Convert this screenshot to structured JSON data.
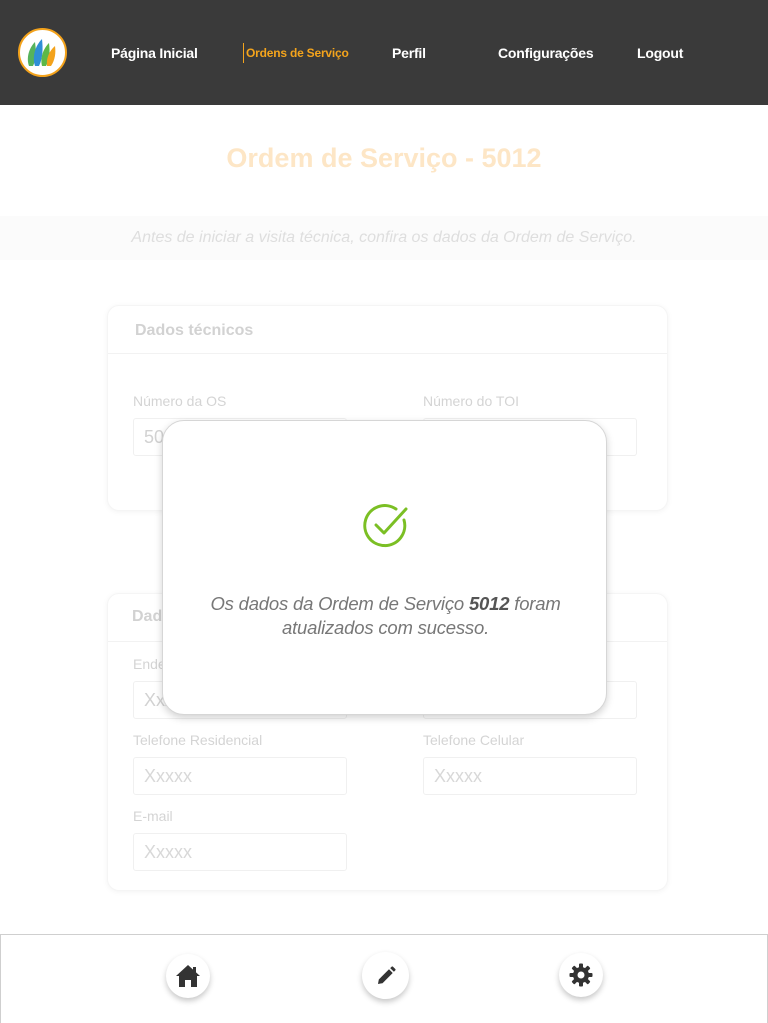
{
  "nav": {
    "items": [
      {
        "label": "Página Inicial",
        "active": false
      },
      {
        "label": "Ordens de Serviço",
        "active": true
      },
      {
        "label": "Perfil",
        "active": false
      },
      {
        "label": "Configurações",
        "active": false
      },
      {
        "label": "Logout",
        "active": false
      }
    ],
    "logo_icon": "company-logo"
  },
  "page": {
    "title": "Ordem de Serviço - 5012",
    "subtitle": "Antes de iniciar a visita técnica, confira os dados da Ordem de Serviço."
  },
  "technical": {
    "title": "Dados técnicos",
    "os_number_label": "Número da OS",
    "os_number_value": "5012",
    "toi_number_label": "Número do TOI",
    "toi_number_value": ""
  },
  "client": {
    "title": "Dados do cliente",
    "address_label": "Endereço",
    "address_value": "Xxxxx",
    "address2_value": "",
    "phone_res_label": "Telefone Residencial",
    "phone_res_placeholder": "Xxxxx",
    "phone_cel_label": "Telefone Celular",
    "phone_cel_placeholder": "Xxxxx",
    "email_label": "E-mail",
    "email_placeholder": "Xxxxx"
  },
  "modal": {
    "icon": "check-circle-icon",
    "message_before": "Os dados da Ordem de Serviço",
    "os_number": "5012",
    "message_after": "foram",
    "message_line2": "atualizados com sucesso."
  },
  "bottom_nav": [
    {
      "icon": "home-icon"
    },
    {
      "icon": "pencil-icon"
    },
    {
      "icon": "gear-icon"
    }
  ],
  "colors": {
    "topbar": "#3a3a3a",
    "accent": "#f4a41c",
    "success": "#7bbf24"
  }
}
